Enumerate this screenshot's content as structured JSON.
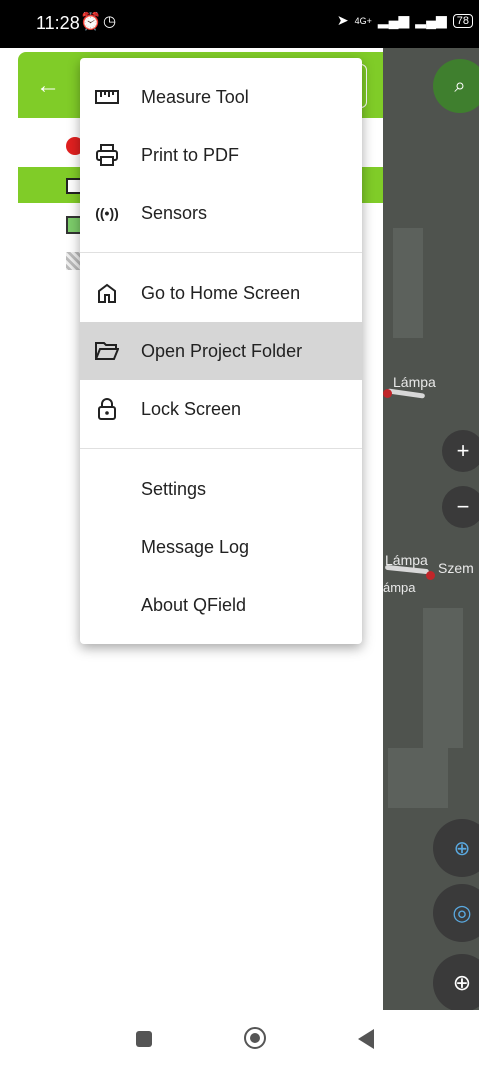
{
  "status_bar": {
    "time": "11:28",
    "network": "4G+",
    "battery": "78"
  },
  "map": {
    "labels": [
      "Lámpa",
      "Lámpa",
      "Szem",
      "ámpa"
    ],
    "zoom_in": "+",
    "zoom_out": "−"
  },
  "menu": {
    "items": [
      {
        "label": "Measure Tool",
        "icon": "ruler-icon"
      },
      {
        "label": "Print to PDF",
        "icon": "printer-icon"
      },
      {
        "label": "Sensors",
        "icon": "sensors-icon"
      },
      {
        "label": "Go to Home Screen",
        "icon": "home-icon"
      },
      {
        "label": "Open Project Folder",
        "icon": "folder-open-icon"
      },
      {
        "label": "Lock Screen",
        "icon": "lock-icon"
      },
      {
        "label": "Settings"
      },
      {
        "label": "Message Log"
      },
      {
        "label": "About QField"
      }
    ],
    "highlighted": "Open Project Folder"
  },
  "colors": {
    "accent": "#80cc28",
    "highlight": "#d6d6d6",
    "point": "#c0262a"
  }
}
